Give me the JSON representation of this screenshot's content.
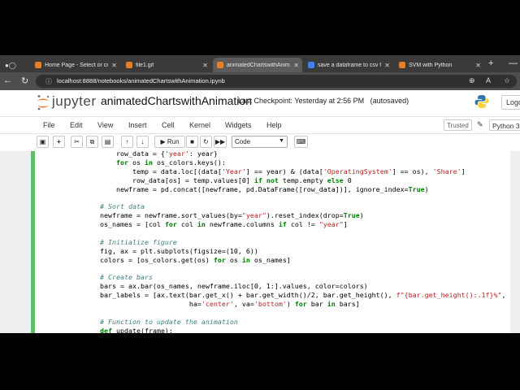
{
  "browser": {
    "tabs": [
      {
        "label": "Home Page - Select or create",
        "fav_color": "#e67e22",
        "active": false
      },
      {
        "label": "file1.gif",
        "fav_color": "#e67e22",
        "active": false
      },
      {
        "label": "animatedChartswithAnimation",
        "fav_color": "#e67e22",
        "active": true
      },
      {
        "label": "save a dataframe to csv file",
        "fav_color": "#3b82f6",
        "active": false
      },
      {
        "label": "SVM with Python",
        "fav_color": "#e67e22",
        "active": false
      }
    ],
    "new_tab": "+",
    "minimize": "—",
    "url": "localhost:8888/notebooks/animatedChartswithAnimation.ipynb"
  },
  "jupyter": {
    "brand": "jupyter",
    "notebook_title": "animatedChartswithAnimation",
    "checkpoint": "Last Checkpoint: Yesterday at 2:56 PM",
    "autosave": "(autosaved)",
    "logout": "Logo",
    "menu": [
      "File",
      "Edit",
      "View",
      "Insert",
      "Cell",
      "Kernel",
      "Widgets",
      "Help"
    ],
    "trusted": "Trusted",
    "kernel": "Python 3",
    "run_label": "Run",
    "cell_type": "Code"
  },
  "code_lines": [
    "    row_data = {'year': year}",
    "    for os in os_colors.keys():",
    "        temp = data.loc[(data['Year'] == year) & (data['OperatingSystem'] == os), 'Share']",
    "        row_data[os] = temp.values[0] if not temp.empty else 0",
    "    newframe = pd.concat([newframe, pd.DataFrame([row_data])], ignore_index=True)",
    "",
    "# Sort data",
    "newframe = newframe.sort_values(by=\"year\").reset_index(drop=True)",
    "os_names = [col for col in newframe.columns if col != \"year\"]",
    "",
    "# Initialize figure",
    "fig, ax = plt.subplots(figsize=(10, 6))",
    "colors = [os_colors.get(os) for os in os_names]",
    "",
    "# Create bars",
    "bars = ax.bar(os_names, newframe.iloc[0, 1:].values, color=colors)",
    "bar_labels = [ax.text(bar.get_x() + bar.get_width()/2, bar.get_height(), f\"{bar.get_height():.1f}%\",",
    "                      ha='center', va='bottom') for bar in bars]",
    "",
    "# Function to update the animation",
    "def update(frame):"
  ]
}
